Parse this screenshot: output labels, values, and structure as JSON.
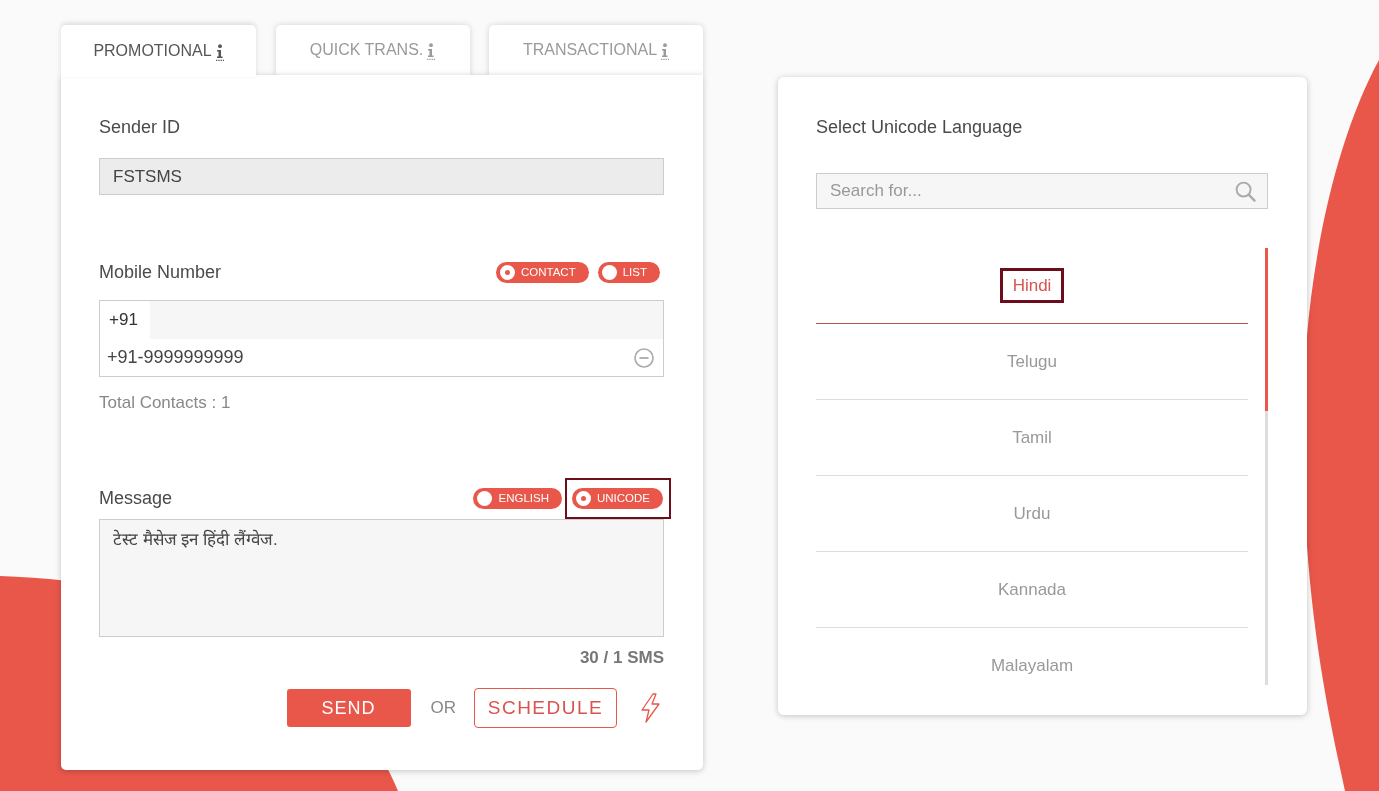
{
  "tabs": [
    {
      "label": "PROMOTIONAL",
      "selected": true
    },
    {
      "label": "QUICK TRANS.",
      "selected": false
    },
    {
      "label": "TRANSACTIONAL",
      "selected": false
    }
  ],
  "sender_id": {
    "label": "Sender ID",
    "value": "FSTSMS"
  },
  "mobile_number": {
    "label": "Mobile Number",
    "options": [
      {
        "label": "CONTACT",
        "selected": true,
        "highlighted": false
      },
      {
        "label": "LIST",
        "selected": false,
        "highlighted": false
      }
    ],
    "country_code": "+91",
    "contacts": [
      "+91-9999999999"
    ],
    "total": "Total Contacts : 1"
  },
  "message": {
    "label": "Message",
    "options": [
      {
        "label": "ENGLISH",
        "selected": false,
        "highlighted": false
      },
      {
        "label": "UNICODE",
        "selected": true,
        "highlighted": true
      }
    ],
    "value": "टेस्ट मैसेज इन हिंदी लैंग्वेज.",
    "counter": "30 / 1 SMS"
  },
  "actions": {
    "send": "SEND",
    "or": "OR",
    "schedule": "SCHEDULE"
  },
  "language_panel": {
    "title": "Select Unicode Language",
    "search": {
      "placeholder": "Search for..."
    },
    "languages": [
      {
        "name": "Hindi",
        "selected": true,
        "highlighted": true
      },
      {
        "name": "Telugu",
        "selected": false,
        "highlighted": false
      },
      {
        "name": "Tamil",
        "selected": false,
        "highlighted": false
      },
      {
        "name": "Urdu",
        "selected": false,
        "highlighted": false
      },
      {
        "name": "Kannada",
        "selected": false,
        "highlighted": false
      },
      {
        "name": "Malayalam",
        "selected": false,
        "highlighted": false
      }
    ]
  }
}
